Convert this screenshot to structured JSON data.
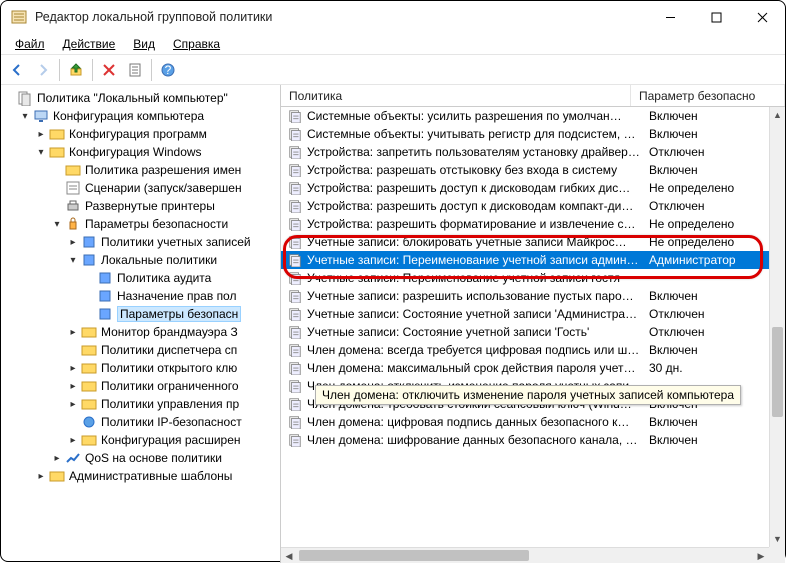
{
  "window": {
    "title": "Редактор локальной групповой политики"
  },
  "menu": {
    "items": [
      "Файл",
      "Действие",
      "Вид",
      "Справка"
    ]
  },
  "tree": {
    "root": "Политика \"Локальный компьютер\"",
    "computer_config": "Конфигурация компьютера",
    "software_policies": "Конфигурация программ",
    "windows_config": "Конфигурация Windows",
    "name_resolution": "Политика разрешения имен",
    "scripts": "Сценарии (запуск/завершен",
    "deployed_printers": "Развернутые принтеры",
    "security_settings": "Параметры безопасности",
    "account_policies": "Политики учетных записей",
    "local_policies": "Локальные политики",
    "audit_policy": "Политика аудита",
    "user_rights": "Назначение прав пол",
    "security_options": "Параметры безопасн",
    "firewall_monitor": "Монитор брандмауэра З",
    "network_list": "Политики диспетчера сп",
    "public_key": "Политики открытого клю",
    "software_restriction": "Политики ограниченного",
    "app_control": "Политики управления пр",
    "ipsec": "Политики IP-безопасност",
    "adv_audit": "Конфигурация расширен",
    "qos": "QoS на основе политики",
    "admin_templates": "Административные шаблоны"
  },
  "columns": {
    "policy": "Политика",
    "param": "Параметр безопасно"
  },
  "rows": [
    {
      "policy": "Системные объекты: усилить разрешения по умолчан…",
      "param": "Включен"
    },
    {
      "policy": "Системные объекты: учитывать регистр для подсистем, …",
      "param": "Включен"
    },
    {
      "policy": "Устройства: запретить пользователям установку драйвер…",
      "param": "Отключен"
    },
    {
      "policy": "Устройства: разрешать отстыковку без входа в систему",
      "param": "Включен"
    },
    {
      "policy": "Устройства: разрешить доступ к дисководам гибких дис…",
      "param": "Не определено"
    },
    {
      "policy": "Устройства: разрешить доступ к дисководам компакт-ди…",
      "param": "Отключен"
    },
    {
      "policy": "Устройства: разрешить форматирование и извлечение с…",
      "param": "Не определено"
    },
    {
      "policy": "Учетные записи: блокировать учетные записи Майкрос…",
      "param": "Не определено"
    },
    {
      "policy": "Учетные записи: Переименование учетной записи админ…",
      "param": "Администратор",
      "selected": true
    },
    {
      "policy": "Учетные записи: Переименование учетной записи гостя",
      "param": ""
    },
    {
      "policy": "Учетные записи: разрешить использование пустых паро…",
      "param": "Включен"
    },
    {
      "policy": "Учетные записи: Состояние учетной записи 'Администра…",
      "param": "Отключен"
    },
    {
      "policy": "Учетные записи: Состояние учетной записи 'Гость'",
      "param": "Отключен"
    },
    {
      "policy": "Член домена: всегда требуется цифровая подпись или ш…",
      "param": "Включен"
    },
    {
      "policy": "Член домена: максимальный срок действия пароля учет…",
      "param": "30 дн."
    },
    {
      "policy": "Член домена: отключить изменение пароля учетных запи…",
      "param": ""
    },
    {
      "policy": "Член домена: требовать стойкий сеансовый ключ (Wind…",
      "param": "Включен"
    },
    {
      "policy": "Член домена: цифровая подпись данных безопасного к…",
      "param": "Включен"
    },
    {
      "policy": "Член домена: шифрование данных безопасного канала, …",
      "param": "Включен"
    }
  ],
  "tooltip": "Член домена: отключить изменение пароля учетных записей компьютера"
}
